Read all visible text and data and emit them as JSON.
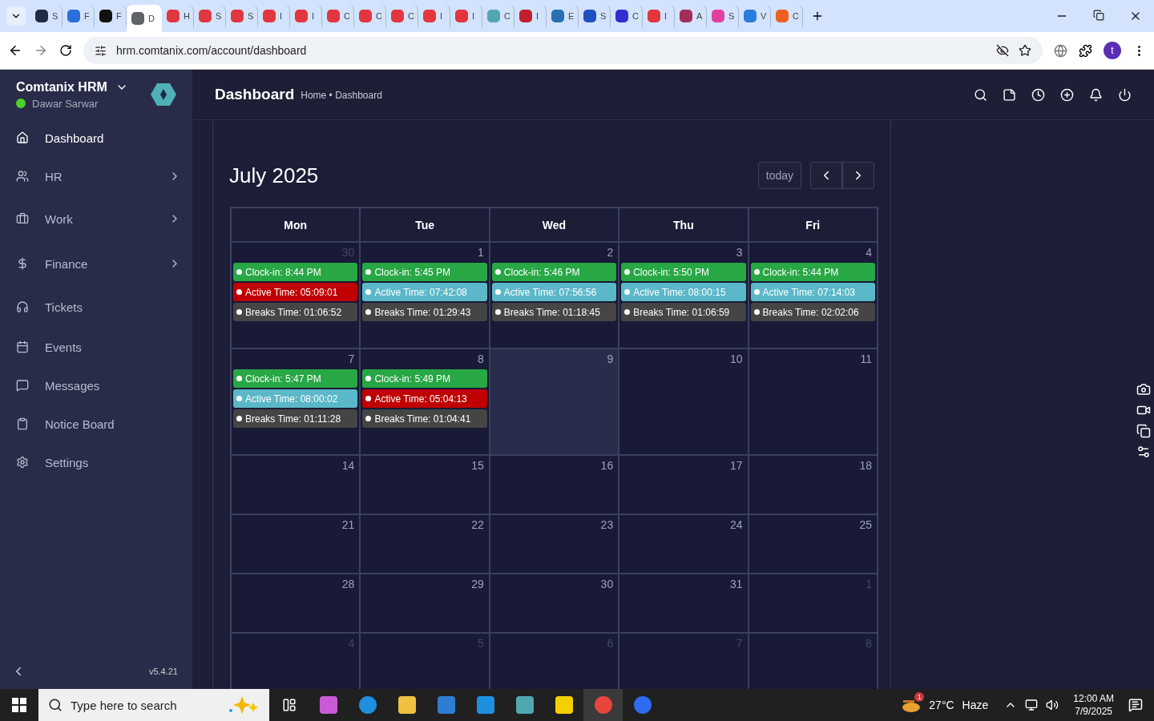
{
  "browser": {
    "tabs": [
      {
        "label": "S",
        "selected": false,
        "color": "#1f2a44"
      },
      {
        "label": "F",
        "selected": false,
        "color": "#2b6fd8"
      },
      {
        "label": "F",
        "selected": false,
        "color": "#111111"
      },
      {
        "label": "D",
        "selected": true,
        "color": "#5f6368"
      },
      {
        "label": "H",
        "selected": false,
        "color": "#e0383e"
      },
      {
        "label": "S",
        "selected": false,
        "color": "#e0383e"
      },
      {
        "label": "S",
        "selected": false,
        "color": "#e0383e"
      },
      {
        "label": "I",
        "selected": false,
        "color": "#e0383e"
      },
      {
        "label": "I",
        "selected": false,
        "color": "#e0383e"
      },
      {
        "label": "C",
        "selected": false,
        "color": "#e0383e"
      },
      {
        "label": "C",
        "selected": false,
        "color": "#e0383e"
      },
      {
        "label": "C",
        "selected": false,
        "color": "#e0383e"
      },
      {
        "label": "I",
        "selected": false,
        "color": "#e0383e"
      },
      {
        "label": "I",
        "selected": false,
        "color": "#e0383e"
      },
      {
        "label": "C",
        "selected": false,
        "color": "#4fa8b0"
      },
      {
        "label": "I",
        "selected": false,
        "color": "#c0202e"
      },
      {
        "label": "E",
        "selected": false,
        "color": "#2a6fb0"
      },
      {
        "label": "S",
        "selected": false,
        "color": "#2050c0"
      },
      {
        "label": "C",
        "selected": false,
        "color": "#3030d0"
      },
      {
        "label": "I",
        "selected": false,
        "color": "#e0383e"
      },
      {
        "label": "A",
        "selected": false,
        "color": "#a0305a"
      },
      {
        "label": "S",
        "selected": false,
        "color": "#e040a0"
      },
      {
        "label": "V",
        "selected": false,
        "color": "#2a7de0"
      },
      {
        "label": "C",
        "selected": false,
        "color": "#f06020"
      }
    ],
    "url": "hrm.comtanix.com/account/dashboard",
    "profile": "t"
  },
  "sidebar": {
    "app_name": "Comtanix HRM",
    "user": "Dawar Sarwar",
    "online": true,
    "version": "v5.4.21",
    "items": [
      {
        "label": "Dashboard",
        "selected": true,
        "expandable": false
      },
      {
        "label": "HR",
        "selected": false,
        "expandable": true
      },
      {
        "label": "Work",
        "selected": false,
        "expandable": true
      },
      {
        "label": "Finance",
        "selected": false,
        "expandable": true
      },
      {
        "label": "Tickets",
        "selected": false,
        "expandable": false
      },
      {
        "label": "Events",
        "selected": false,
        "expandable": false
      },
      {
        "label": "Messages",
        "selected": false,
        "expandable": false
      },
      {
        "label": "Notice Board",
        "selected": false,
        "expandable": false
      },
      {
        "label": "Settings",
        "selected": false,
        "expandable": false
      }
    ]
  },
  "header": {
    "title": "Dashboard",
    "breadcrumb": "Home • Dashboard"
  },
  "calendar": {
    "title": "July 2025",
    "today_button": "today",
    "columns": [
      "Mon",
      "Tue",
      "Wed",
      "Thu",
      "Fri"
    ],
    "weeks": [
      {
        "days": [
          {
            "num": "30",
            "other_month": true,
            "today": false,
            "events": [
              {
                "text": "Clock-in: 8:44 PM",
                "color": "#28a745"
              },
              {
                "text": "Active Time: 05:09:01",
                "color": "#c00000"
              },
              {
                "text": "Breaks Time: 01:06:52",
                "color": "#454545"
              }
            ]
          },
          {
            "num": "1",
            "other_month": false,
            "today": false,
            "events": [
              {
                "text": "Clock-in: 5:45 PM",
                "color": "#28a745"
              },
              {
                "text": "Active Time: 07:42:08",
                "color": "#5bb8c8"
              },
              {
                "text": "Breaks Time: 01:29:43",
                "color": "#454545"
              }
            ]
          },
          {
            "num": "2",
            "other_month": false,
            "today": false,
            "events": [
              {
                "text": "Clock-in: 5:46 PM",
                "color": "#28a745"
              },
              {
                "text": "Active Time: 07:56:56",
                "color": "#5bb8c8"
              },
              {
                "text": "Breaks Time: 01:18:45",
                "color": "#454545"
              }
            ]
          },
          {
            "num": "3",
            "other_month": false,
            "today": false,
            "events": [
              {
                "text": "Clock-in: 5:50 PM",
                "color": "#28a745"
              },
              {
                "text": "Active Time: 08:00:15",
                "color": "#5bb8c8"
              },
              {
                "text": "Breaks Time: 01:06:59",
                "color": "#454545"
              }
            ]
          },
          {
            "num": "4",
            "other_month": false,
            "today": false,
            "events": [
              {
                "text": "Clock-in: 5:44 PM",
                "color": "#28a745"
              },
              {
                "text": "Active Time: 07:14:03",
                "color": "#5bb8c8"
              },
              {
                "text": "Breaks Time: 02:02:06",
                "color": "#454545"
              }
            ]
          }
        ]
      },
      {
        "days": [
          {
            "num": "7",
            "other_month": false,
            "today": false,
            "events": [
              {
                "text": "Clock-in: 5:47 PM",
                "color": "#28a745"
              },
              {
                "text": "Active Time: 08:00:02",
                "color": "#5bb8c8"
              },
              {
                "text": "Breaks Time: 01:11:28",
                "color": "#454545"
              }
            ]
          },
          {
            "num": "8",
            "other_month": false,
            "today": false,
            "events": [
              {
                "text": "Clock-in: 5:49 PM",
                "color": "#28a745"
              },
              {
                "text": "Active Time: 05:04:13",
                "color": "#c00000"
              },
              {
                "text": "Breaks Time: 01:04:41",
                "color": "#454545"
              }
            ]
          },
          {
            "num": "9",
            "other_month": false,
            "today": true
          },
          {
            "num": "10",
            "other_month": false,
            "today": false
          },
          {
            "num": "11",
            "other_month": false,
            "today": false
          }
        ]
      },
      {
        "days": [
          {
            "num": "14",
            "other_month": false,
            "today": false
          },
          {
            "num": "15",
            "other_month": false,
            "today": false
          },
          {
            "num": "16",
            "other_month": false,
            "today": false
          },
          {
            "num": "17",
            "other_month": false,
            "today": false
          },
          {
            "num": "18",
            "other_month": false,
            "today": false
          }
        ]
      },
      {
        "days": [
          {
            "num": "21",
            "other_month": false,
            "today": false
          },
          {
            "num": "22",
            "other_month": false,
            "today": false
          },
          {
            "num": "23",
            "other_month": false,
            "today": false
          },
          {
            "num": "24",
            "other_month": false,
            "today": false
          },
          {
            "num": "25",
            "other_month": false,
            "today": false
          }
        ]
      },
      {
        "days": [
          {
            "num": "28",
            "other_month": false,
            "today": false
          },
          {
            "num": "29",
            "other_month": false,
            "today": false
          },
          {
            "num": "30",
            "other_month": false,
            "today": false
          },
          {
            "num": "31",
            "other_month": false,
            "today": false
          },
          {
            "num": "1",
            "other_month": true,
            "today": false
          }
        ]
      },
      {
        "days": [
          {
            "num": "4",
            "other_month": true,
            "today": false
          },
          {
            "num": "5",
            "other_month": true,
            "today": false
          },
          {
            "num": "6",
            "other_month": true,
            "today": false
          },
          {
            "num": "7",
            "other_month": true,
            "today": false
          },
          {
            "num": "8",
            "other_month": true,
            "today": false
          }
        ]
      }
    ]
  },
  "taskbar": {
    "search_placeholder": "Type here to search",
    "weather_badge": "1",
    "temperature": "27°C",
    "weather": "Haze",
    "time": "12:00 AM",
    "date": "7/9/2025"
  }
}
